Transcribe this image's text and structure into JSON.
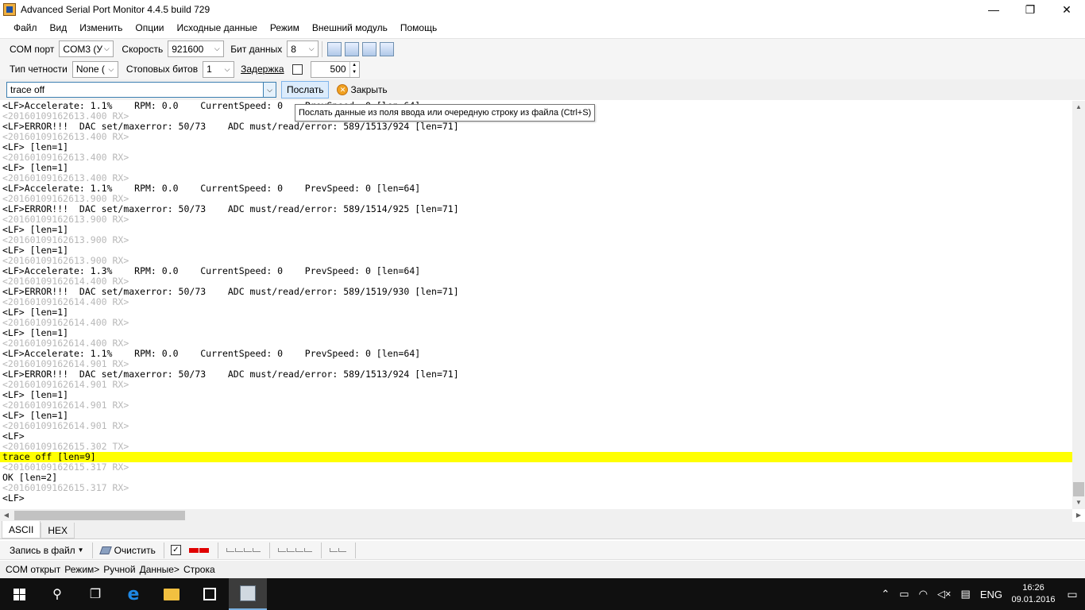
{
  "window": {
    "title": "Advanced Serial Port Monitor 4.4.5 build 729",
    "min": "—",
    "max": "❐",
    "close": "✕"
  },
  "menu": [
    "Файл",
    "Вид",
    "Изменить",
    "Опции",
    "Исходные данные",
    "Режим",
    "Внешний модуль",
    "Помощь"
  ],
  "toolbar1": {
    "com_label": "COM порт",
    "com_value": "COM3 (У",
    "speed_label": "Скорость",
    "speed_value": "921600",
    "bits_label": "Бит данных",
    "bits_value": "8"
  },
  "toolbar2": {
    "parity_label": "Тип четности",
    "parity_value": "None (",
    "stop_label": "Стоповых битов",
    "stop_value": "1",
    "delay_label": "Задержка",
    "delay_value": "500"
  },
  "toolbar3": {
    "send_input_value": "trace off",
    "send_label": "Послать",
    "close_label": "Закрыть"
  },
  "tooltip": "Послать данные из поля ввода или очередную строку из файла (Ctrl+S)",
  "log": [
    {
      "t": "data",
      "text": "<LF>Accelerate: 1.1%    RPM: 0.0    CurrentSpeed: 0    PrevSpeed: 0 [len=64]"
    },
    {
      "t": "ts",
      "text": "<20160109162613.400 RX>"
    },
    {
      "t": "data",
      "text": "<LF>ERROR!!!  DAC set/maxerror: 50/73    ADC must/read/error: 589/1513/924 [len=71]"
    },
    {
      "t": "ts",
      "text": "<20160109162613.400 RX>"
    },
    {
      "t": "data",
      "text": "<LF> [len=1]"
    },
    {
      "t": "ts",
      "text": "<20160109162613.400 RX>"
    },
    {
      "t": "data",
      "text": "<LF> [len=1]"
    },
    {
      "t": "ts",
      "text": "<20160109162613.400 RX>"
    },
    {
      "t": "data",
      "text": "<LF>Accelerate: 1.1%    RPM: 0.0    CurrentSpeed: 0    PrevSpeed: 0 [len=64]"
    },
    {
      "t": "ts",
      "text": "<20160109162613.900 RX>"
    },
    {
      "t": "data",
      "text": "<LF>ERROR!!!  DAC set/maxerror: 50/73    ADC must/read/error: 589/1514/925 [len=71]"
    },
    {
      "t": "ts",
      "text": "<20160109162613.900 RX>"
    },
    {
      "t": "data",
      "text": "<LF> [len=1]"
    },
    {
      "t": "ts",
      "text": "<20160109162613.900 RX>"
    },
    {
      "t": "data",
      "text": "<LF> [len=1]"
    },
    {
      "t": "ts",
      "text": "<20160109162613.900 RX>"
    },
    {
      "t": "data",
      "text": "<LF>Accelerate: 1.3%    RPM: 0.0    CurrentSpeed: 0    PrevSpeed: 0 [len=64]"
    },
    {
      "t": "ts",
      "text": "<20160109162614.400 RX>"
    },
    {
      "t": "data",
      "text": "<LF>ERROR!!!  DAC set/maxerror: 50/73    ADC must/read/error: 589/1519/930 [len=71]"
    },
    {
      "t": "ts",
      "text": "<20160109162614.400 RX>"
    },
    {
      "t": "data",
      "text": "<LF> [len=1]"
    },
    {
      "t": "ts",
      "text": "<20160109162614.400 RX>"
    },
    {
      "t": "data",
      "text": "<LF> [len=1]"
    },
    {
      "t": "ts",
      "text": "<20160109162614.400 RX>"
    },
    {
      "t": "data",
      "text": "<LF>Accelerate: 1.1%    RPM: 0.0    CurrentSpeed: 0    PrevSpeed: 0 [len=64]"
    },
    {
      "t": "ts",
      "text": "<20160109162614.901 RX>"
    },
    {
      "t": "data",
      "text": "<LF>ERROR!!!  DAC set/maxerror: 50/73    ADC must/read/error: 589/1513/924 [len=71]"
    },
    {
      "t": "ts",
      "text": "<20160109162614.901 RX>"
    },
    {
      "t": "data",
      "text": "<LF> [len=1]"
    },
    {
      "t": "ts",
      "text": "<20160109162614.901 RX>"
    },
    {
      "t": "data",
      "text": "<LF> [len=1]"
    },
    {
      "t": "ts",
      "text": "<20160109162614.901 RX>"
    },
    {
      "t": "data",
      "text": "<LF>"
    },
    {
      "t": "ts",
      "text": "<20160109162615.302 TX>"
    },
    {
      "t": "hl",
      "text": "trace off [len=9]"
    },
    {
      "t": "ts",
      "text": "<20160109162615.317 RX>"
    },
    {
      "t": "data",
      "text": "OK [len=2]"
    },
    {
      "t": "ts",
      "text": "<20160109162615.317 RX>"
    },
    {
      "t": "data",
      "text": "<LF>"
    }
  ],
  "tabs": [
    "ASCII",
    "HEX"
  ],
  "bottombar": {
    "record_label": "Запись в файл",
    "clear_label": "Очистить"
  },
  "status": [
    "COM открыт",
    "Режим>",
    "Ручной",
    "Данные>",
    "Строка"
  ],
  "taskbar": {
    "lang": "ENG",
    "time": "16:26",
    "date": "09.01.2016"
  },
  "colors": {
    "highlight": "#ffff00",
    "timestamp": "#b8b8b8",
    "taskbar": "#101010"
  }
}
